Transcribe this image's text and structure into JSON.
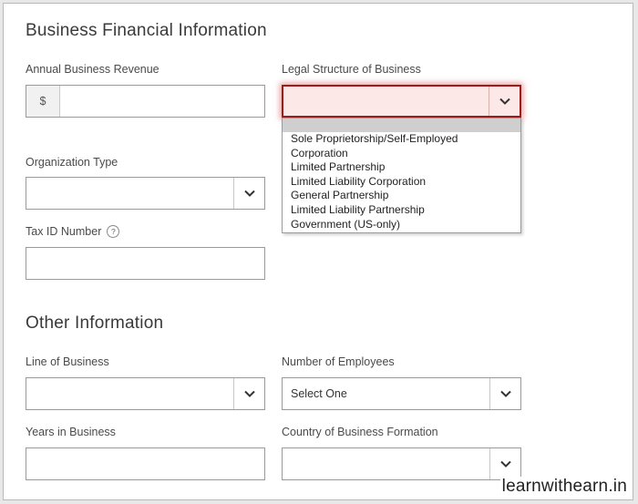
{
  "sections": {
    "financial": {
      "title": "Business Financial Information"
    },
    "other": {
      "title": "Other Information"
    }
  },
  "fields": {
    "annual_revenue": {
      "label": "Annual Business Revenue",
      "prefix": "$",
      "value": ""
    },
    "legal_structure": {
      "label": "Legal Structure of Business",
      "value": "",
      "options": [
        "",
        "Sole Proprietorship/Self-Employed",
        "Corporation",
        "Limited Partnership",
        "Limited Liability Corporation",
        "General Partnership",
        "Limited Liability Partnership",
        "Government (US-only)"
      ]
    },
    "organization_type": {
      "label": "Organization Type",
      "value": ""
    },
    "tax_id": {
      "label": "Tax ID Number",
      "help": "?",
      "value": ""
    },
    "line_of_business": {
      "label": "Line of Business",
      "value": ""
    },
    "number_of_employees": {
      "label": "Number of Employees",
      "value": "Select One"
    },
    "years_in_business": {
      "label": "Years in Business",
      "value": ""
    },
    "country_of_formation": {
      "label": "Country of Business Formation",
      "value": ""
    }
  },
  "watermark": "learnwithearn.in",
  "icons": {
    "chevron": "chevron-down-icon"
  },
  "colors": {
    "focus_border": "#9c1c1c",
    "focus_bg": "#fde8e8",
    "border": "#9a9a9a"
  }
}
